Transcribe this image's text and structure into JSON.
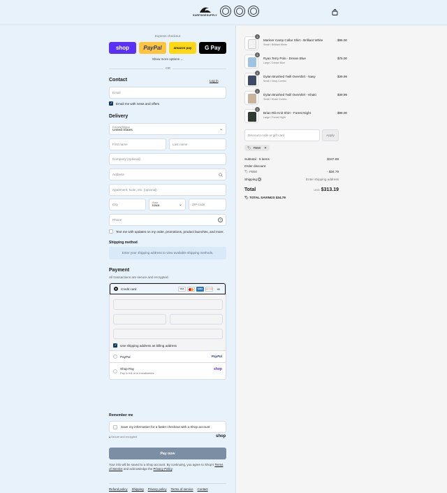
{
  "header": {
    "brand": "SURFSIDESUPPLY",
    "seals": [
      "seal-1-icon",
      "seal-2-icon",
      "seal-3-icon"
    ],
    "cart_icon": "shopping-bag-icon"
  },
  "express": {
    "label": "Express checkout",
    "buttons": [
      {
        "label": "shop",
        "color": "#5a31f4"
      },
      {
        "label": "PayPal",
        "color": "#ffc439"
      },
      {
        "label": "amazon pay",
        "color": "#ffd814"
      },
      {
        "label": "G Pay",
        "color": "#000000"
      }
    ],
    "more_options": "Show more options",
    "or": "OR"
  },
  "contact": {
    "title": "Contact",
    "login": "Log in",
    "email_placeholder": "Email",
    "news_label": "Email me with news and offers"
  },
  "delivery": {
    "title": "Delivery",
    "country_label": "Country/Region",
    "country_value": "United States",
    "first_name": "First name",
    "last_name": "Last name",
    "company": "Company (optional)",
    "address": "Address",
    "apartment": "Apartment, suite, etc. (optional)",
    "city": "City",
    "state_label": "State",
    "state_value": "Iowa",
    "zip": "ZIP code",
    "phone": "Phone",
    "text_label": "Text me with updates on my order, promotions, product launches, and more."
  },
  "shipping": {
    "title": "Shipping method",
    "message": "Enter your shipping address to view available shipping methods."
  },
  "payment": {
    "title": "Payment",
    "subtitle": "All transactions are secure and encrypted.",
    "credit_card": "Credit card",
    "cards": [
      "VISA",
      "MC",
      "AMEX",
      "DISCOVER"
    ],
    "more_cards": "+5",
    "billing_label": "Use shipping address as billing address",
    "paypal_label": "PayPal",
    "paypal_logo": "PayPal",
    "shoppay_label": "Shop Pay",
    "shoppay_sub": "Pay in full or in installments",
    "shoppay_logo": "shop"
  },
  "remember": {
    "title": "Remember me",
    "label": "Save my information for a faster checkout with a Shop account",
    "secure": "Secure and encrypted",
    "shop_logo": "shop"
  },
  "pay_now": "Pay now",
  "terms": {
    "text1": "Your info will be saved to a Shop account. By continuing, you agree to Shop's",
    "tos": "Terms of Service",
    "text2": "and acknowledge the",
    "privacy": "Privacy Policy",
    "end": "."
  },
  "footer": [
    "Refund policy",
    "Shipping",
    "Privacy policy",
    "Terms of service",
    "Contact"
  ],
  "order": {
    "items": [
      {
        "name": "Mariner Camp Collar Shirt - Brilliant White",
        "variant": "Small / Brilliant White",
        "price": "$95.00",
        "qty": "1",
        "color": "#f2f2f2"
      },
      {
        "name": "Ryan Terry Polo - Dream Blue",
        "variant": "Large / Dream Blue",
        "price": "$75.00",
        "qty": "1",
        "color": "#9fc4e3"
      },
      {
        "name": "Dylan Brushed Twill Overshirt - Navy",
        "variant": "Small / Navy Combo",
        "price": "$39.99",
        "qty": "1",
        "color": "#3d4a66"
      },
      {
        "name": "Dylan Brushed Twill Overshirt - Khaki",
        "variant": "Small / Khaki Combo",
        "price": "$39.99",
        "qty": "1",
        "color": "#c9b39a"
      },
      {
        "name": "Brian Rib Knit Shirt - Forest Night",
        "variant": "Large / Forest Night",
        "price": "$98.00",
        "qty": "1",
        "color": "#2f3a32"
      }
    ],
    "discount_placeholder": "Discount code or gift card",
    "apply": "Apply",
    "code_tag": "FB50",
    "subtotal_label": "Subtotal · 5 items",
    "subtotal_value": "$347.98",
    "order_discount_label": "Order discount",
    "discount_code": "FB50",
    "discount_value": "- $34.79",
    "shipping_label": "Shipping",
    "shipping_value": "Enter shipping address",
    "total_label": "Total",
    "currency": "USD",
    "total_value": "$313.19",
    "savings_label": "TOTAL SAVINGS",
    "savings_value": "$34.79"
  }
}
